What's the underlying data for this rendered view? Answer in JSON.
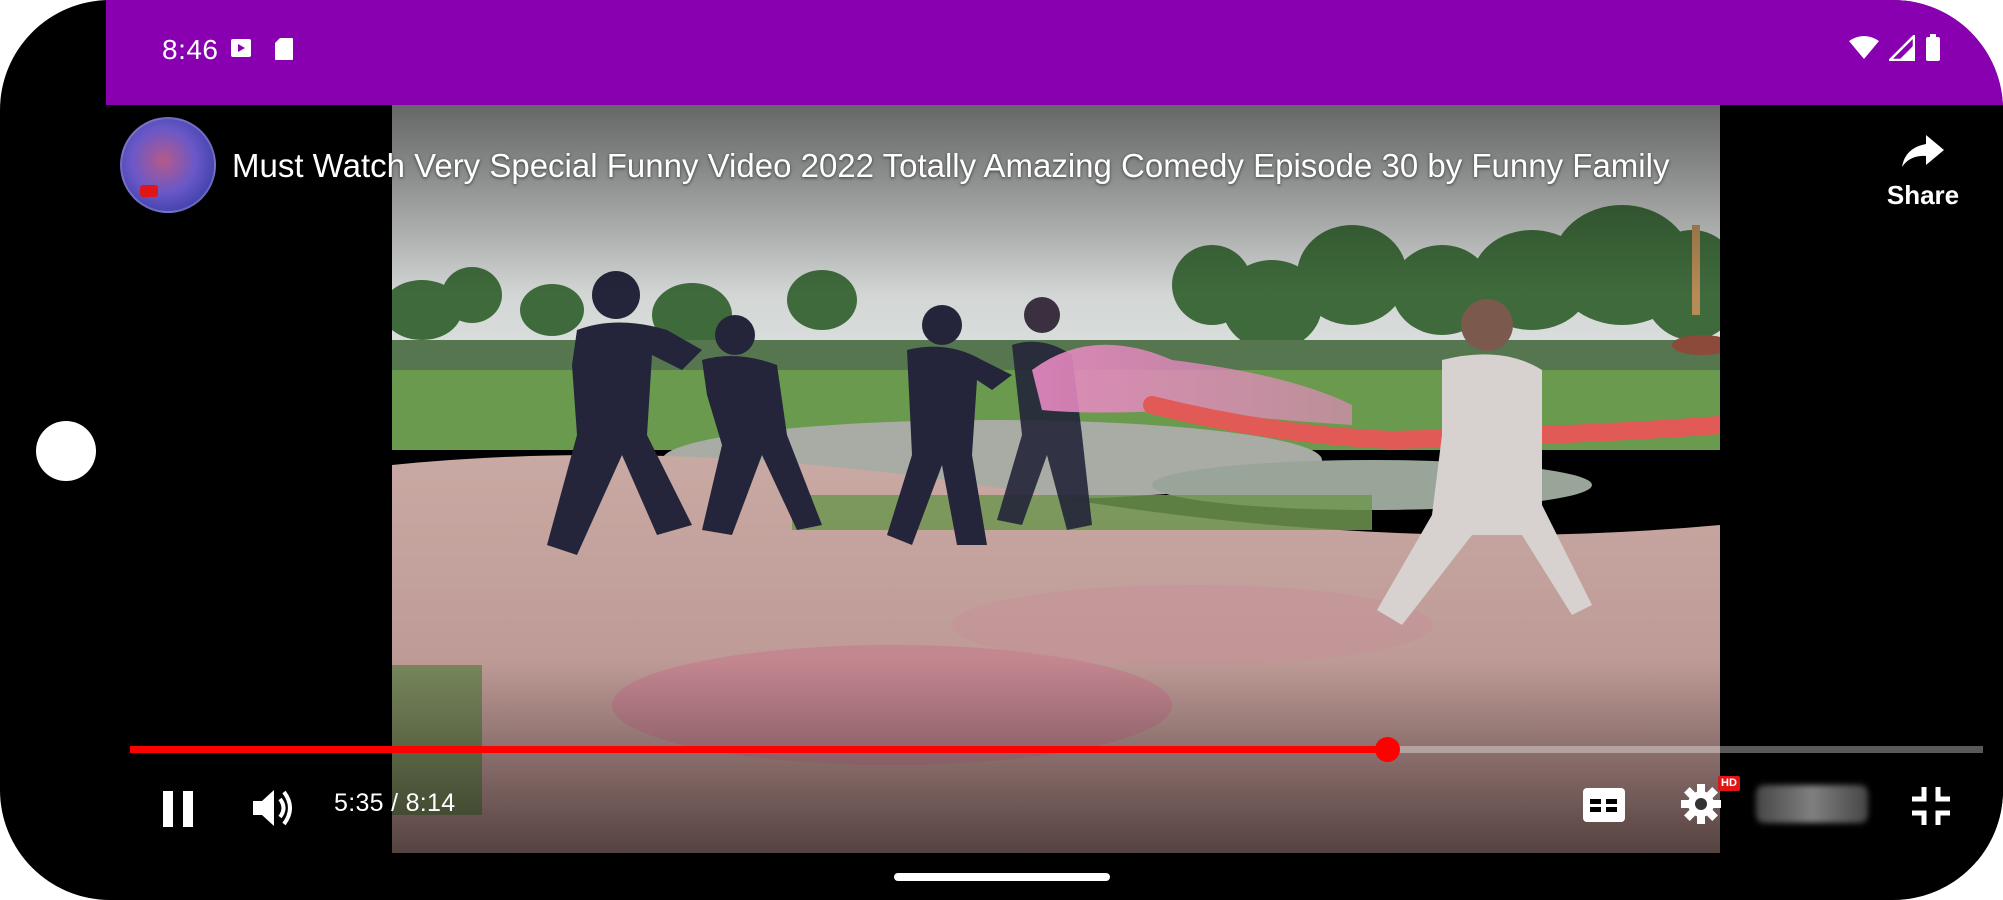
{
  "status_bar": {
    "time": "8:46",
    "left_icons": [
      "media-icon",
      "sd-card-icon"
    ],
    "right_icons": [
      "wifi-icon",
      "signal-icon",
      "battery-icon"
    ],
    "background": "#8900b0"
  },
  "player": {
    "title": "Must Watch Very Special Funny Video 2022 Totally Amazing Comedy Episode 30 by Funny Family",
    "share_label": "Share",
    "time_display": "5:35 / 8:14",
    "progress": 0.6784,
    "progress_color": "#ff0000",
    "hd_badge": "HD",
    "controls": [
      "pause-icon",
      "volume-icon",
      "captions-icon",
      "settings-icon",
      "exit-fullscreen-icon"
    ]
  }
}
